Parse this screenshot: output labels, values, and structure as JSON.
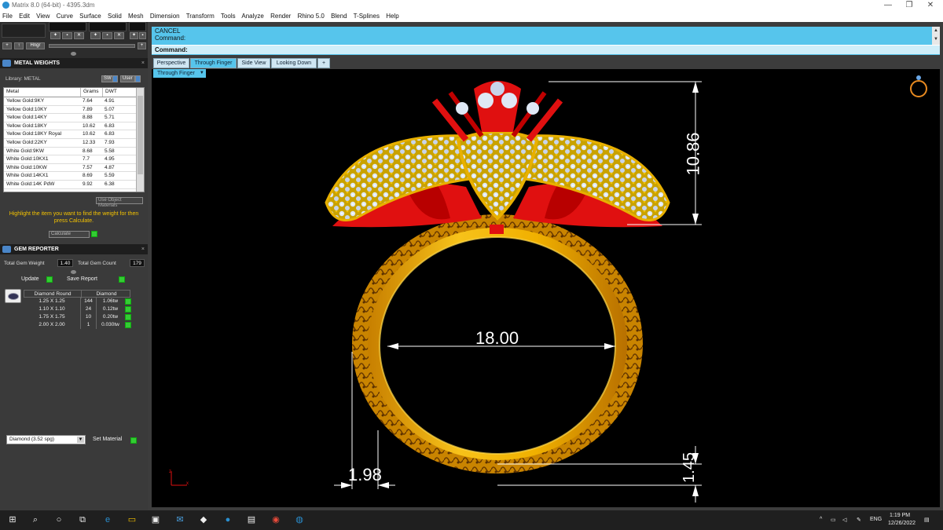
{
  "window": {
    "title": "Matrix 8.0 (64-bit) - 4395.3dm",
    "controls": [
      "—",
      "❐",
      "✕"
    ]
  },
  "menu": [
    "File",
    "Edit",
    "View",
    "Curve",
    "Surface",
    "Solid",
    "Mesh",
    "Dimension",
    "Transform",
    "Tools",
    "Analyze",
    "Render",
    "Rhino 5.0",
    "Blend",
    "T-Splines",
    "Help"
  ],
  "toolstrip": {
    "hinge_label": "Hngr"
  },
  "metal_weights": {
    "title": "METAL WEIGHTS",
    "library_label": "Library: METAL",
    "sw_label": "SW",
    "user_label": "User",
    "columns": [
      "Metal",
      "Grams",
      "DWT"
    ],
    "rows": [
      [
        "Yellow Gold:9KY",
        "7.64",
        "4.91"
      ],
      [
        "Yellow Gold:10KY",
        "7.89",
        "5.07"
      ],
      [
        "Yellow Gold:14KY",
        "8.88",
        "5.71"
      ],
      [
        "Yellow Gold:18KY",
        "10.62",
        "6.83"
      ],
      [
        "Yellow Gold:18KY Royal",
        "10.62",
        "6.83"
      ],
      [
        "Yellow Gold:22KY",
        "12.33",
        "7.93"
      ],
      [
        "White Gold:9KW",
        "8.68",
        "5.58"
      ],
      [
        "White Gold:10KX1",
        "7.7",
        "4.95"
      ],
      [
        "White Gold:10KW",
        "7.57",
        "4.87"
      ],
      [
        "White Gold:14KX1",
        "8.69",
        "5.59"
      ],
      [
        "White Gold:14K PdW",
        "9.92",
        "6.38"
      ]
    ],
    "use_object_materials": "Use Object Materials",
    "hint": "Highlight the item you want to find the weight for then press Calculate.",
    "calculate": "Calculate"
  },
  "gem_reporter": {
    "title": "GEM REPORTER",
    "total_weight_label": "Total Gem Weight",
    "total_weight": "1.40",
    "total_count_label": "Total Gem Count",
    "total_count": "179",
    "update": "Update",
    "save_report": "Save Report",
    "headers": [
      "Diamond Round",
      "Diamond"
    ],
    "rows": [
      [
        "1.25 X 1.25",
        "144",
        "1.06tw"
      ],
      [
        "1.10 X 1.10",
        "24",
        "0.12tw"
      ],
      [
        "1.75 X 1.75",
        "10",
        "0.20tw"
      ],
      [
        "2.00 X 2.00",
        "1",
        "0.030tw"
      ]
    ]
  },
  "material": {
    "selected": "Diamond     (3.52 spg)",
    "set_material": "Set Material"
  },
  "command": {
    "line1": "CANCEL",
    "line2": "Command:",
    "prompt": "Command:"
  },
  "viewport_tabs": [
    "Perspective",
    "Through Finger",
    "Side View",
    "Looking Down",
    "+"
  ],
  "active_viewport": "Through Finger",
  "dimensions": {
    "ring_diameter": "18.00",
    "head_height": "10.86",
    "band_width": "1.98",
    "band_thickness": "1.45"
  },
  "axis": {
    "z": "z",
    "x": "x"
  },
  "taskbar": {
    "lang": "ENG",
    "time": "1:19 PM",
    "date": "12/26/2022"
  },
  "colors": {
    "command_bg": "#56c5ec",
    "gold": "#e0a800",
    "red": "#e01010",
    "hint": "#f5c300"
  }
}
